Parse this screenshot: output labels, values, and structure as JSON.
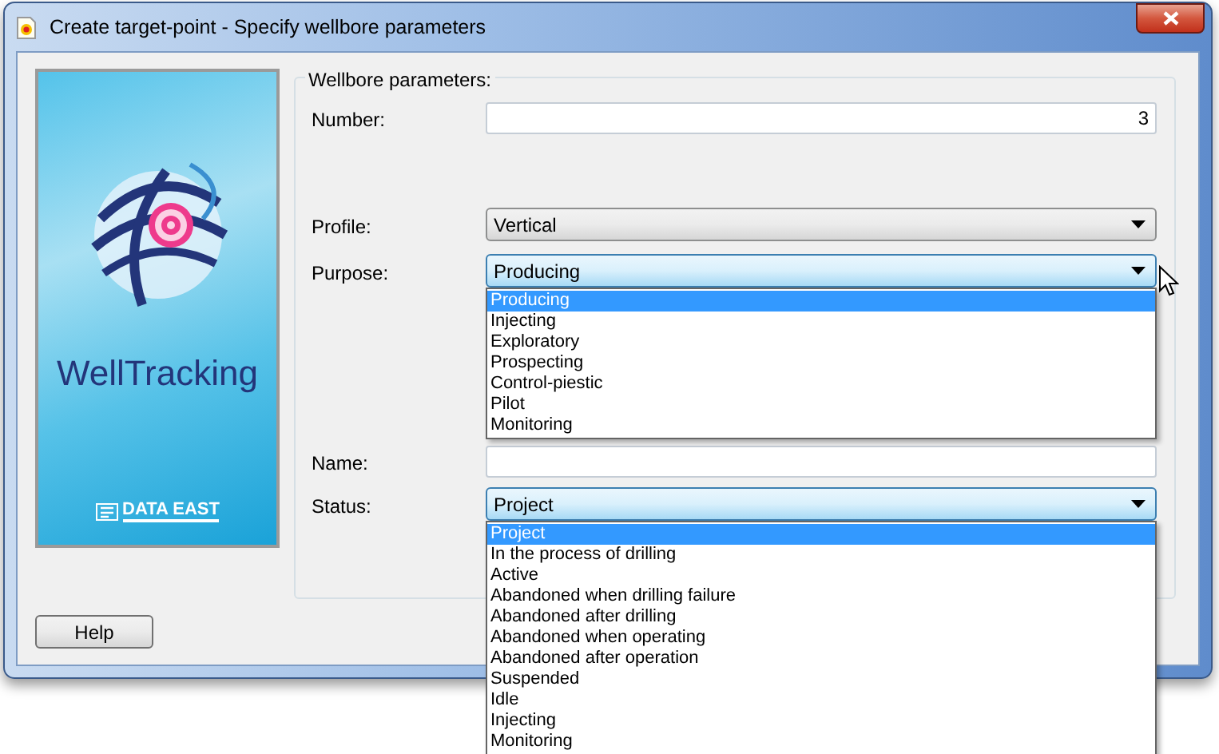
{
  "window": {
    "title": "Create target-point - Specify wellbore parameters"
  },
  "banner": {
    "product": "WellTracking",
    "company": "DATA EAST"
  },
  "group": {
    "title": "Wellbore parameters:"
  },
  "fields": [
    {
      "kind": "text",
      "label": "Number:",
      "value": "3"
    },
    {
      "kind": "combo",
      "label": "Profile:",
      "value": "Vertical",
      "open": false
    },
    {
      "kind": "combo",
      "label": "Purpose:",
      "value": "Producing",
      "open": true,
      "options": [
        {
          "label": "Producing",
          "selected": true
        },
        {
          "label": "Injecting",
          "selected": false
        },
        {
          "label": "Exploratory",
          "selected": false
        },
        {
          "label": "Prospecting",
          "selected": false
        },
        {
          "label": "Control-piestic",
          "selected": false
        },
        {
          "label": "Pilot",
          "selected": false
        },
        {
          "label": "Monitoring",
          "selected": false
        }
      ]
    },
    {
      "kind": "text",
      "label": "Name:"
    },
    {
      "kind": "combo",
      "label": "Status:",
      "value": "Project",
      "open": true,
      "options": [
        {
          "label": "Project",
          "selected": true
        },
        {
          "label": "In the process of drilling",
          "selected": false
        },
        {
          "label": "Active",
          "selected": false
        },
        {
          "label": "Abandoned when drilling failure",
          "selected": false
        },
        {
          "label": "Abandoned after drilling",
          "selected": false
        },
        {
          "label": "Abandoned when operating",
          "selected": false
        },
        {
          "label": "Abandoned after operation",
          "selected": false
        },
        {
          "label": "Suspended",
          "selected": false
        },
        {
          "label": "Idle",
          "selected": false
        },
        {
          "label": "Injecting",
          "selected": false
        },
        {
          "label": "Monitoring",
          "selected": false
        }
      ]
    }
  ],
  "buttons": [
    {
      "label": "Help"
    }
  ]
}
